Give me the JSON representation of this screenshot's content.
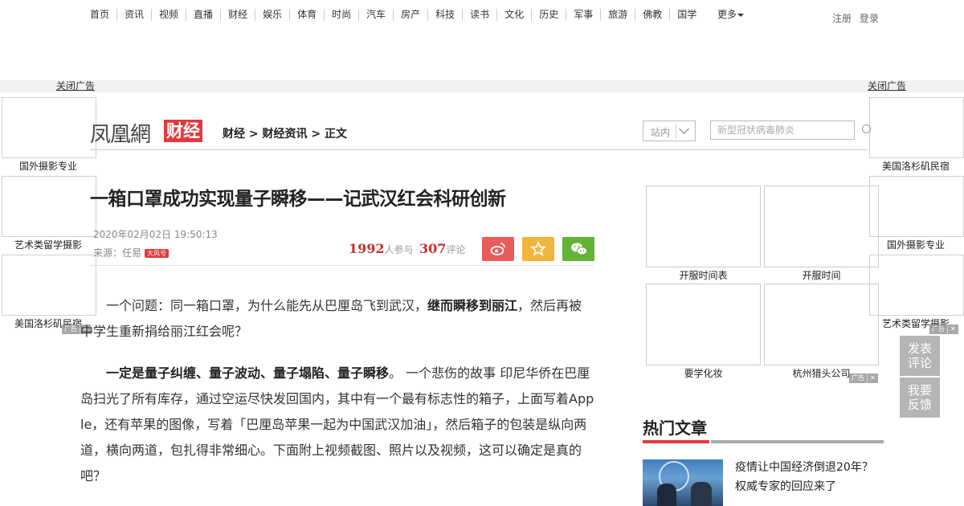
{
  "nav": {
    "items": [
      "首页",
      "资讯",
      "视频",
      "直播",
      "财经",
      "娱乐",
      "体育",
      "时尚",
      "汽车",
      "房产",
      "科技",
      "读书",
      "文化",
      "历史",
      "军事",
      "旅游",
      "佛教",
      "国学"
    ],
    "more": "更多",
    "register": "注册",
    "login": "登录"
  },
  "ads": {
    "close_left": "关闭广告",
    "close_right": "关闭广告",
    "left_labels": [
      "国外摄影专业",
      "艺术类留学摄影",
      "美国洛杉矶民宿"
    ],
    "right_labels": [
      "美国洛杉矶民宿",
      "国外摄影专业",
      "艺术类留学摄影"
    ],
    "tag": "广告",
    "tag_close": "✕",
    "r_labels": [
      "开服时间表",
      "开服时间",
      "要学化妆",
      "杭州猎头公司"
    ]
  },
  "header": {
    "logo_text": "凤凰網",
    "channel": "财经",
    "breadcrumb": "财经 > 财经资讯 > 正文",
    "site_select": "站内",
    "search_placeholder": "新型冠状病毒肺炎"
  },
  "article": {
    "title": "一箱口罩成功实现量子瞬移——记武汉红会科研创新",
    "time": "2020年02月02日 19:50:13",
    "source": "来源：任易",
    "source_badge": "大风号",
    "participants": "1992",
    "participants_label": "人参与",
    "comments": "307",
    "comments_label": "评论",
    "p1_a": "一个问题：同一箱口罩，为什么能先从巴厘岛飞到武汉，",
    "p1_b": "继而瞬移到丽江",
    "p1_c": "，然后再被中学生重新捐给丽江红会呢？",
    "p2_a": "一定是量子纠缠、量子波动、量子塌陷、量子瞬移",
    "p2_b": "。 一个悲伤的故事 印尼华侨在巴厘岛扫光了所有库存，通过空运尽快发回国内，其中有一个最有标志性的箱子，上面写着Apple，还有苹果的图像，写着「巴厘岛苹果一起为中国武汉加油」，然后箱子的包装是纵向两道，横向两道，包扎得非常细心。下面附上视频截图、照片以及视频，这可以确定是真的吧？"
  },
  "sidebar": {
    "hot_title": "热门文章",
    "hot_item": "疫情让中国经济倒退20年？权威专家的回应来了"
  },
  "feedback": {
    "comment": "发表评论",
    "report": "我要反馈"
  },
  "colors": {
    "brand_red": "#e4393c",
    "weibo": "#e85c5c",
    "favorite": "#f0b53a",
    "wechat": "#63b337"
  }
}
